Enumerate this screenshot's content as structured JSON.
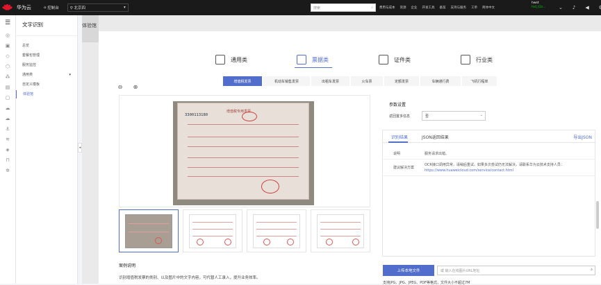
{
  "topbar": {
    "brand": "华为云",
    "console": "控制台",
    "region": "北京四",
    "search_placeholder": "搜索",
    "links": [
      "费用与成本",
      "资源",
      "企业",
      "开发工具",
      "备案",
      "支持与服务",
      "工单",
      "简体中文"
    ],
    "user_name": "hwst",
    "user_id": "hid_t2z..."
  },
  "sidebar": {
    "title": "文字识别",
    "items": [
      {
        "label": "总览",
        "active": false,
        "caret": ""
      },
      {
        "label": "套餐包管理",
        "active": false,
        "caret": ""
      },
      {
        "label": "服务监控",
        "active": false,
        "caret": ""
      },
      {
        "label": "通用类",
        "active": false,
        "caret": "▾"
      },
      {
        "label": "自定义模板",
        "active": false,
        "caret": ""
      },
      {
        "label": "体验馆",
        "active": true,
        "caret": ""
      }
    ]
  },
  "page_tab": "体验馆",
  "categories": [
    {
      "label": "通用类",
      "active": false
    },
    {
      "label": "票据类",
      "active": true
    },
    {
      "label": "证件类",
      "active": false
    },
    {
      "label": "行业类",
      "active": false
    }
  ],
  "subtabs": [
    {
      "label": "增值税发票",
      "active": true
    },
    {
      "label": "机动车销售发票",
      "active": false
    },
    {
      "label": "出租车发票",
      "active": false
    },
    {
      "label": "火车票",
      "active": false
    },
    {
      "label": "定额发票",
      "active": false
    },
    {
      "label": "车辆通行费",
      "active": false
    },
    {
      "label": "飞机行程单",
      "active": false
    }
  ],
  "invoice": {
    "title": "增值税专用发票",
    "number": "3300113180"
  },
  "case": {
    "heading": "案例说明",
    "text": "识别增值税发票的类别、以及图片中的文字内容，可代替人工录入，提升业务效率。"
  },
  "params": {
    "heading": "参数设置",
    "label": "返回置多信息",
    "value": "否"
  },
  "result": {
    "tab_result": "识别结果",
    "tab_json": "JSON返回结果",
    "export": "导出JSON",
    "rows": [
      {
        "key": "说明",
        "value": "服务请求出错。",
        "link": ""
      },
      {
        "key": "建议解决方案",
        "value": "OCR接口调用异常，请稍后重试。如果多次尝试仍无法解决，请联系华为云技术支持人员：",
        "link": "https://www.huaweicloud.com/service/contact.html"
      }
    ]
  },
  "upload": {
    "button": "上传本地文件",
    "url_placeholder": "或 输入在线图片URL地址",
    "formats": "支持JPG、JPG、JPEG、PDF等格式，文件大小不超过7M"
  },
  "colors": {
    "accent": "#526ecc",
    "topbar": "#1a1a1a",
    "brand_red": "#e3162b"
  }
}
